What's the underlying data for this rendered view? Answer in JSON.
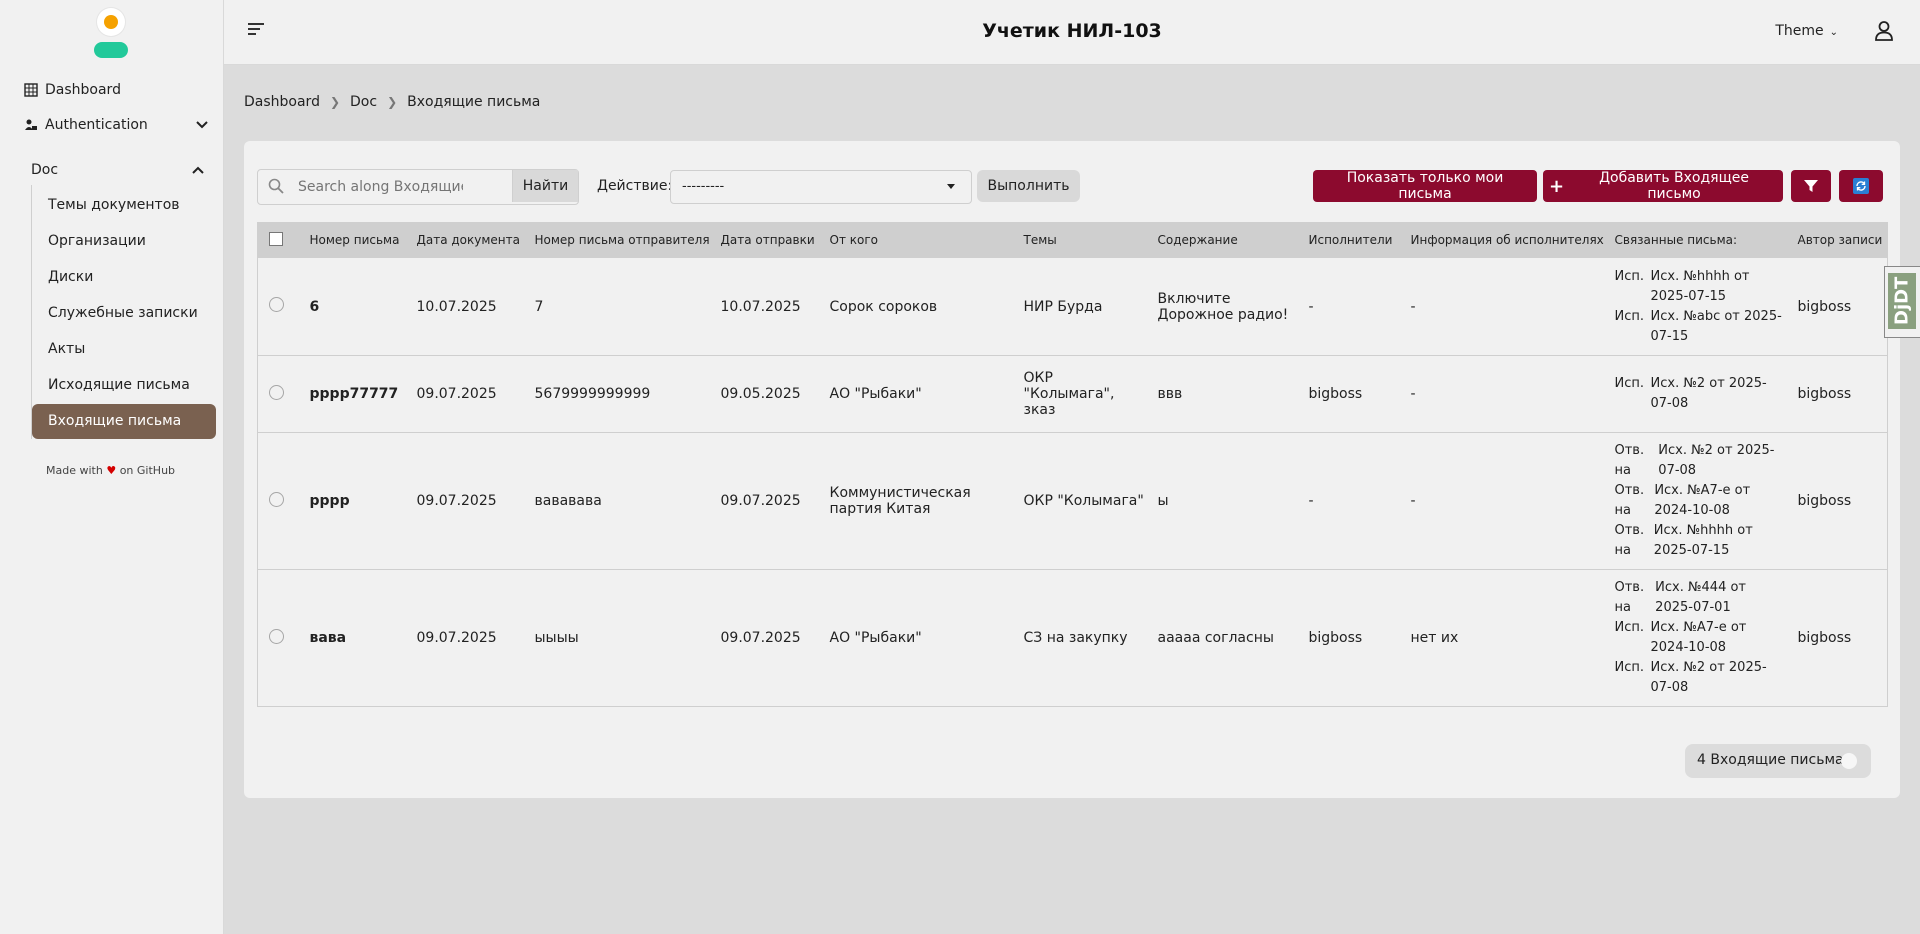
{
  "app_title": "Учетик НИЛ-103",
  "header": {
    "theme_label": "Theme"
  },
  "sidebar": {
    "dashboard": "Dashboard",
    "authentication": "Authentication",
    "doc": "Doc",
    "doc_items": [
      "Темы документов",
      "Организации",
      "Диски",
      "Служебные записки",
      "Акты",
      "Исходящие письма"
    ],
    "active_item": "Входящие письма",
    "made_with": "Made with",
    "on_github": "on GitHub"
  },
  "breadcrumb": [
    "Dashboard",
    "Doc",
    "Входящие письма"
  ],
  "toolbar": {
    "search_placeholder": "Search along Входящие письма",
    "search_button": "Найти",
    "action_label": "Действие:",
    "action_value": "---------",
    "execute": "Выполнить",
    "show_mine": "Показать только мои письма",
    "add_letter": "Добавить Входящее письмо"
  },
  "table": {
    "columns": [
      "Номер письма",
      "Дата документа",
      "Номер письма отправителя",
      "Дата отправки",
      "От кого",
      "Темы",
      "Содержание",
      "Исполнители",
      "Информация об исполнителях",
      "Связанные письма:",
      "Автор записи"
    ],
    "rows": [
      {
        "num": "6",
        "doc_date": "10.07.2025",
        "sender_num": "7",
        "send_date": "10.07.2025",
        "from": "Сорок сороков",
        "topics": "НИР Бурда",
        "content": "Включите Дорожное радио!",
        "executors": "-",
        "exec_info": "-",
        "related": [
          {
            "k": "Исп.",
            "v": "Исх. №hhhh от 2025-07-15"
          },
          {
            "k": "Исп.",
            "v": "Исх. №abc от 2025-07-15"
          }
        ],
        "author": "bigboss"
      },
      {
        "num": "рррр77777",
        "doc_date": "09.07.2025",
        "sender_num": "5679999999999",
        "send_date": "09.05.2025",
        "from": "АО \"Рыбаки\"",
        "topics": "ОКР \"Колымага\", зказ",
        "content": "ввв",
        "executors": "bigboss",
        "exec_info": "-",
        "related": [
          {
            "k": "Исп.",
            "v": "Исх. №2 от 2025-07-08"
          }
        ],
        "author": "bigboss"
      },
      {
        "num": "рррр",
        "doc_date": "09.07.2025",
        "sender_num": "вававава",
        "send_date": "09.07.2025",
        "from": "Коммунистическая партия Китая",
        "topics": "ОКР \"Колымага\"",
        "content": "ы",
        "executors": "-",
        "exec_info": "-",
        "related": [
          {
            "k": "Отв. на",
            "v": "Исх. №2 от 2025-07-08"
          },
          {
            "k": "Отв. на",
            "v": "Исх. №А7-е от 2024-10-08"
          },
          {
            "k": "Отв. на",
            "v": "Исх. №hhhh от 2025-07-15"
          }
        ],
        "author": "bigboss"
      },
      {
        "num": "вава",
        "doc_date": "09.07.2025",
        "sender_num": "ыыыы",
        "send_date": "09.07.2025",
        "from": "АО \"Рыбаки\"",
        "topics": "СЗ на закупку",
        "content": "ааааа согласны",
        "executors": "bigboss",
        "exec_info": "нет их",
        "related": [
          {
            "k": "Отв. на",
            "v": "Исх. №444 от 2025-07-01"
          },
          {
            "k": "Исп.",
            "v": "Исх. №А7-е от 2024-10-08"
          },
          {
            "k": "Исп.",
            "v": "Исх. №2 от 2025-07-08"
          }
        ],
        "author": "bigboss"
      }
    ]
  },
  "footer": {
    "count_label": "4 Входящие письма"
  },
  "debug_toolbar": "DjDT",
  "colors": {
    "accent": "#8c0a2e",
    "active_item": "#7a6150",
    "link": "#1f7ab8"
  }
}
